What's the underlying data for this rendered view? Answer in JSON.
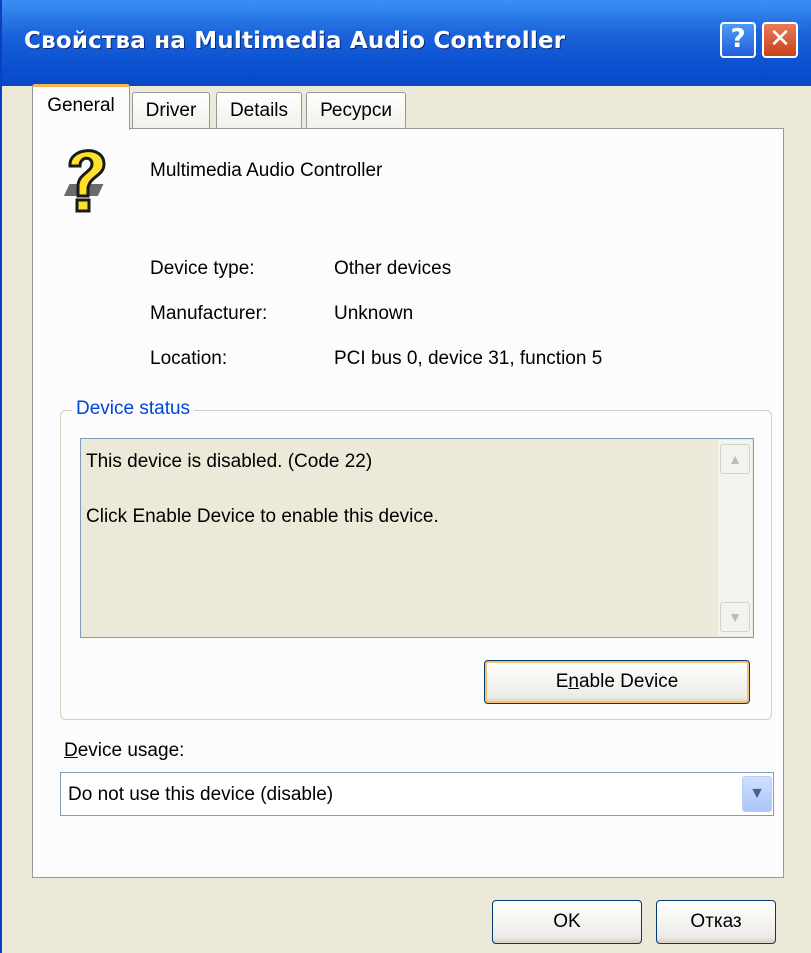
{
  "window": {
    "title": "Свойства на Multimedia Audio Controller",
    "help_label": "?",
    "close_label": "✕"
  },
  "tabs": [
    {
      "label": "General",
      "active": true
    },
    {
      "label": "Driver",
      "active": false
    },
    {
      "label": "Details",
      "active": false
    },
    {
      "label": "Ресурси",
      "active": false
    }
  ],
  "general": {
    "device_icon": "unknown-device-question-mark-icon",
    "device_name": "Multimedia Audio Controller",
    "properties": [
      {
        "label": "Device type:",
        "value": "Other devices"
      },
      {
        "label": "Manufacturer:",
        "value": "Unknown"
      },
      {
        "label": "Location:",
        "value": "PCI bus 0, device 31, function 5"
      }
    ],
    "status_group": {
      "caption": "Device status",
      "line1": "This device is disabled. (Code 22)",
      "line2": "Click Enable Device to enable this device.",
      "enable_button": {
        "pre": "E",
        "mnemonic": "n",
        "post": "able Device"
      }
    },
    "usage": {
      "label_mnemonic": "D",
      "label_rest": "evice usage:",
      "selected": "Do not use this device (disable)"
    }
  },
  "footer": {
    "ok_label": "OK",
    "cancel_label": "Отказ"
  },
  "colors": {
    "titlebar": "#0a4fd0",
    "dialog_bg": "#ece9d8",
    "panel_bg": "#fcfcfe",
    "group_caption": "#0046d5",
    "active_tab_accent": "#f7b64c"
  }
}
